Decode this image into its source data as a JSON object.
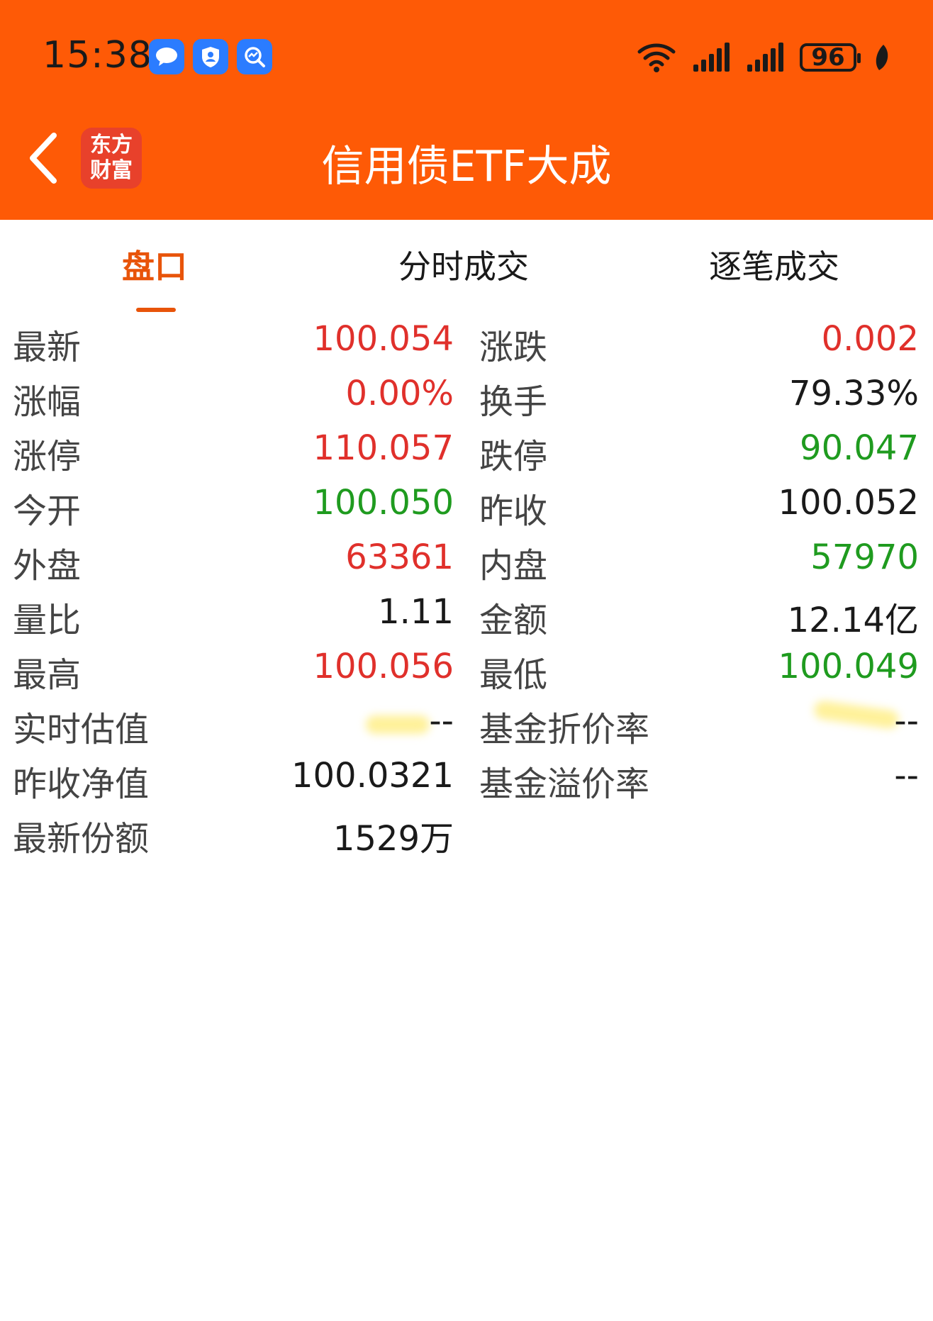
{
  "status_bar": {
    "time": "15:38",
    "battery": "96",
    "app_icons": [
      "message-icon",
      "shield-person-icon",
      "search-chart-icon"
    ]
  },
  "header": {
    "logo_line1": "东方",
    "logo_line2": "财富",
    "title": "信用债ETF大成",
    "bg_color": "#fe5a06"
  },
  "tabs": [
    {
      "label": "盘口",
      "active": true
    },
    {
      "label": "分时成交",
      "active": false
    },
    {
      "label": "逐笔成交",
      "active": false
    }
  ],
  "colors": {
    "up": "#e0302b",
    "down": "#1f9b1f",
    "accent": "#e8540a"
  },
  "quotes": [
    {
      "left_label": "最新",
      "left_value": "100.054",
      "right_label": "涨跌",
      "right_value": "0.002"
    },
    {
      "left_label": "涨幅",
      "left_value": "0.00%",
      "right_label": "换手",
      "right_value": "79.33%"
    },
    {
      "left_label": "涨停",
      "left_value": "110.057",
      "right_label": "跌停",
      "right_value": "90.047"
    },
    {
      "left_label": "今开",
      "left_value": "100.050",
      "right_label": "昨收",
      "right_value": "100.052"
    },
    {
      "left_label": "外盘",
      "left_value": "63361",
      "right_label": "内盘",
      "right_value": "57970"
    },
    {
      "left_label": "量比",
      "left_value": "1.11",
      "right_label": "金额",
      "right_value": "12.14亿"
    },
    {
      "left_label": "最高",
      "left_value": "100.056",
      "right_label": "最低",
      "right_value": "100.049"
    },
    {
      "left_label": "实时估值",
      "left_value": "--",
      "right_label": "基金折价率",
      "right_value": "--"
    },
    {
      "left_label": "昨收净值",
      "left_value": "100.0321",
      "right_label": "基金溢价率",
      "right_value": "--"
    },
    {
      "left_label": "最新份额",
      "left_value": "1529万",
      "right_label": "",
      "right_value": ""
    }
  ]
}
